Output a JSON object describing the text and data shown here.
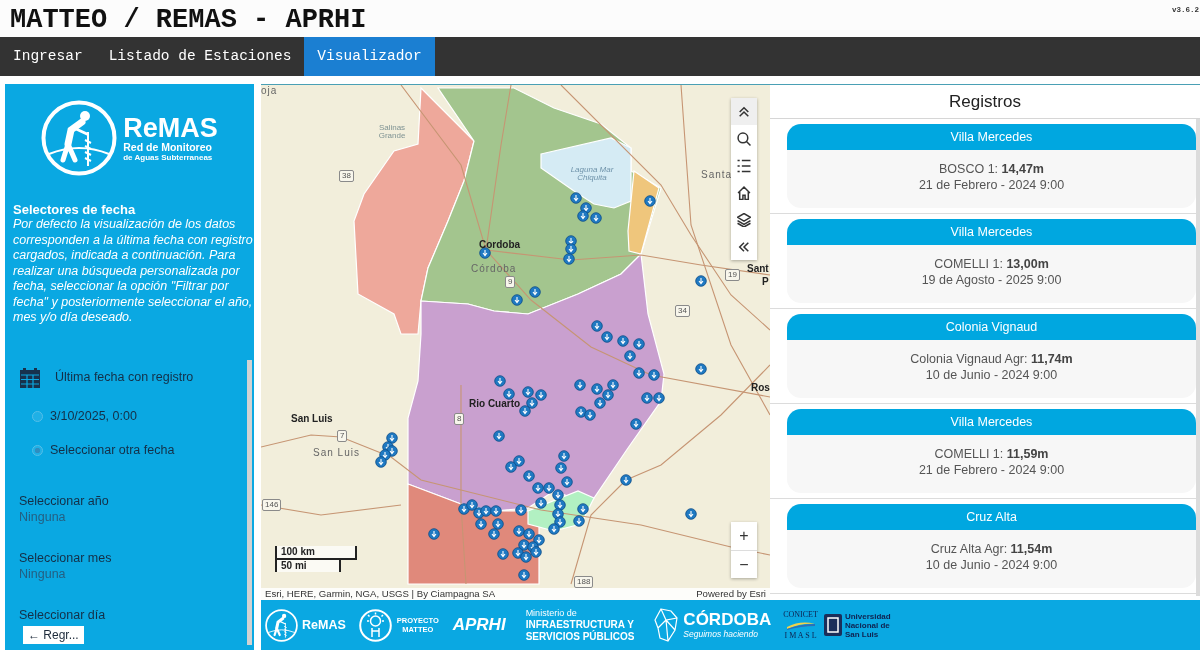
{
  "header": {
    "title": "MATTEO / REMAS - APRHI",
    "version": "v3.6.2"
  },
  "nav": [
    {
      "label": "Ingresar",
      "selected": false
    },
    {
      "label": "Listado de Estaciones",
      "selected": false
    },
    {
      "label": "Visualizador",
      "selected": true
    }
  ],
  "sidebar": {
    "logo": {
      "name": "ReMAS",
      "subtitle": [
        "Red de Monitoreo",
        "de Aguas Subterraneas"
      ]
    },
    "section_title": "Selectores de fecha",
    "description": "Por defecto la visualización de los datos corresponden a la última fecha con registro cargados, indicada a continuación. Para realizar una búsqueda personalizada por fecha, seleccionar la opción \"Filtrar por fecha\" y posteriormente seleccionar el año, mes y/o día deseado.",
    "date_mode": {
      "label": "Última fecha con registro",
      "options": [
        {
          "label": "3/10/2025, 0:00",
          "selected": false
        },
        {
          "label": "Seleccionar otra fecha",
          "selected": true
        }
      ]
    },
    "selectors": [
      {
        "label": "Seleccionar año",
        "placeholder": "Ninguna"
      },
      {
        "label": "Seleccionar mes",
        "placeholder": "Ninguna"
      },
      {
        "label": "Seleccionar día"
      }
    ],
    "back_button": "← Regr..."
  },
  "map": {
    "labels": [
      {
        "text": "oja",
        "kind": "province"
      },
      {
        "text": "Salinas Grande",
        "kind": "feature"
      },
      {
        "text": "38",
        "kind": "road"
      },
      {
        "text": "Laguna Mar Chiquita",
        "kind": "water"
      },
      {
        "text": "Santa",
        "kind": "province"
      },
      {
        "text": "Cordoba",
        "kind": "city"
      },
      {
        "text": "Córdoba",
        "kind": "province"
      },
      {
        "text": "9",
        "kind": "road"
      },
      {
        "text": "19",
        "kind": "road"
      },
      {
        "text": "Sant",
        "kind": "city"
      },
      {
        "text": "P",
        "kind": "city"
      },
      {
        "text": "34",
        "kind": "road"
      },
      {
        "text": "Ros",
        "kind": "city"
      },
      {
        "text": "Rio Cuarto",
        "kind": "city"
      },
      {
        "text": "8",
        "kind": "road"
      },
      {
        "text": "San Luis",
        "kind": "city"
      },
      {
        "text": "7",
        "kind": "road"
      },
      {
        "text": "San Luis",
        "kind": "province"
      },
      {
        "text": "146",
        "kind": "road"
      },
      {
        "text": "188",
        "kind": "road"
      }
    ],
    "zoom_in": "+",
    "zoom_out": "−",
    "scale": [
      "100 km",
      "50 mi"
    ],
    "attribution": "Esri, HERE, Garmin, NGA, USGS | By Ciampagna SA",
    "powered_by": "Powered by Esri"
  },
  "records": {
    "title": "Registros",
    "items": [
      {
        "station": "Villa Mercedes",
        "reading": "BOSCO 1: **14,47m**",
        "date": "21 de Febrero - 2024 9:00"
      },
      {
        "station": "Villa Mercedes",
        "reading": "COMELLI 1: **13,00m**",
        "date": "19 de Agosto - 2025 9:00"
      },
      {
        "station": "Colonia Vignaud",
        "reading": "Colonia Vignaud Agr: **11,74m**",
        "date": "10 de Junio - 2024 9:00"
      },
      {
        "station": "Villa Mercedes",
        "reading": "COMELLI 1: **11,59m**",
        "date": "21 de Febrero - 2024 9:00"
      },
      {
        "station": "Cruz Alta",
        "reading": "Cruz Alta Agr: **11,54m**",
        "date": "10 de Junio - 2024 9:00"
      }
    ]
  },
  "footer": {
    "remas": "ReMAS",
    "matteo": [
      "PROYECTO",
      "MATTEO"
    ],
    "aprhi": "APRHI",
    "ministry": {
      "lead": "Ministerio de",
      "name": [
        "INFRAESTRUCTURA Y",
        "SERVICIOS PÚBLICOS"
      ]
    },
    "cordoba": {
      "name": "CÓRDOBA",
      "slogan": "Seguimos haciendo"
    },
    "conicet": {
      "name": "CONICET",
      "institute": "I M A S L"
    },
    "university": [
      "Universidad",
      "Nacional de",
      "San Luis"
    ]
  }
}
